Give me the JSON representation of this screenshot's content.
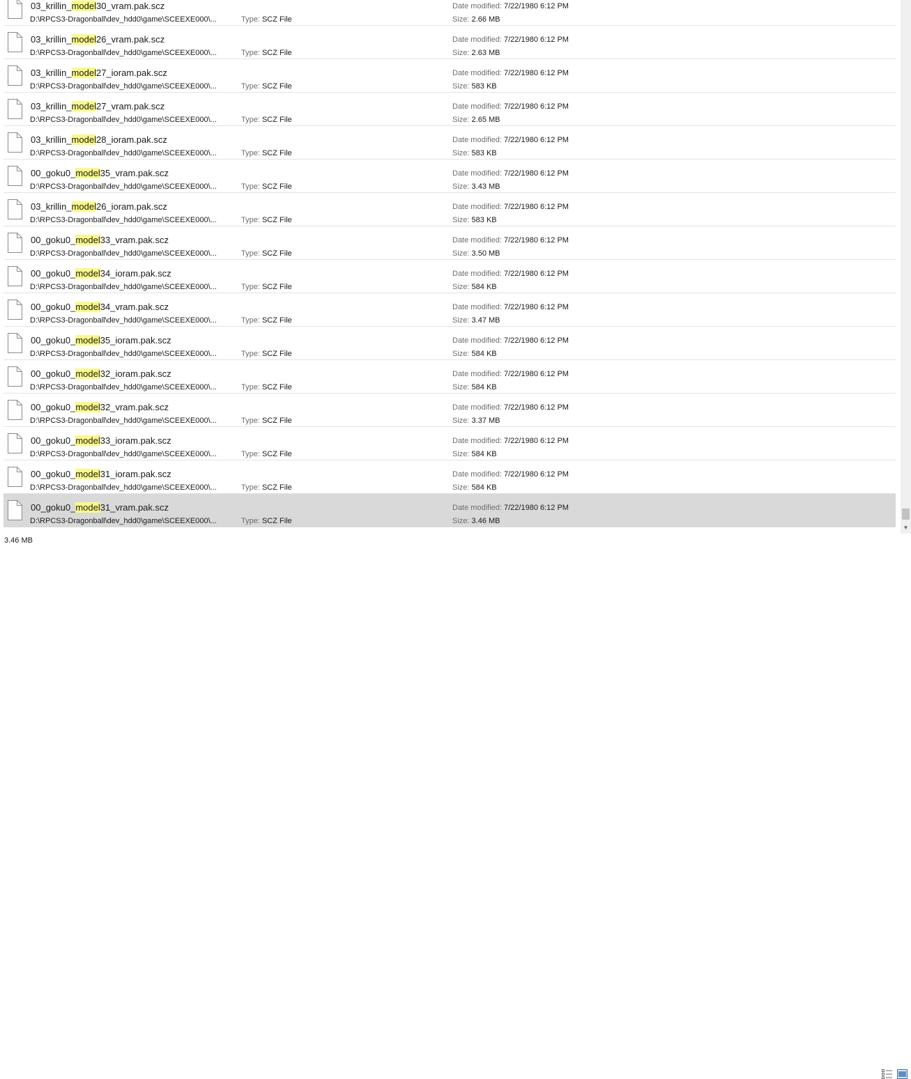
{
  "rows": [
    {
      "name_pre": "03_krillin_",
      "name_hl": "model",
      "name_post": "30_vram.pak.scz",
      "path": "D:\\RPCS3-Dragonball\\dev_hdd0\\game\\SCEEXE000\\...",
      "type_label": "Type:",
      "type": "SCZ File",
      "date_label": "Date modified:",
      "date": "7/22/1980 6:12 PM",
      "size_label": "Size:",
      "size": "2.66 MB"
    },
    {
      "name_pre": "03_krillin_",
      "name_hl": "model",
      "name_post": "26_vram.pak.scz",
      "path": "D:\\RPCS3-Dragonball\\dev_hdd0\\game\\SCEEXE000\\...",
      "type_label": "Type:",
      "type": "SCZ File",
      "date_label": "Date modified:",
      "date": "7/22/1980 6:12 PM",
      "size_label": "Size:",
      "size": "2.63 MB"
    },
    {
      "name_pre": "03_krillin_",
      "name_hl": "model",
      "name_post": "27_ioram.pak.scz",
      "path": "D:\\RPCS3-Dragonball\\dev_hdd0\\game\\SCEEXE000\\...",
      "type_label": "Type:",
      "type": "SCZ File",
      "date_label": "Date modified:",
      "date": "7/22/1980 6:12 PM",
      "size_label": "Size:",
      "size": "583 KB"
    },
    {
      "name_pre": "03_krillin_",
      "name_hl": "model",
      "name_post": "27_vram.pak.scz",
      "path": "D:\\RPCS3-Dragonball\\dev_hdd0\\game\\SCEEXE000\\...",
      "type_label": "Type:",
      "type": "SCZ File",
      "date_label": "Date modified:",
      "date": "7/22/1980 6:12 PM",
      "size_label": "Size:",
      "size": "2.65 MB"
    },
    {
      "name_pre": "03_krillin_",
      "name_hl": "model",
      "name_post": "28_ioram.pak.scz",
      "path": "D:\\RPCS3-Dragonball\\dev_hdd0\\game\\SCEEXE000\\...",
      "type_label": "Type:",
      "type": "SCZ File",
      "date_label": "Date modified:",
      "date": "7/22/1980 6:12 PM",
      "size_label": "Size:",
      "size": "583 KB"
    },
    {
      "name_pre": "00_goku0_",
      "name_hl": "model",
      "name_post": "35_vram.pak.scz",
      "path": "D:\\RPCS3-Dragonball\\dev_hdd0\\game\\SCEEXE000\\...",
      "type_label": "Type:",
      "type": "SCZ File",
      "date_label": "Date modified:",
      "date": "7/22/1980 6:12 PM",
      "size_label": "Size:",
      "size": "3.43 MB"
    },
    {
      "name_pre": "03_krillin_",
      "name_hl": "model",
      "name_post": "26_ioram.pak.scz",
      "path": "D:\\RPCS3-Dragonball\\dev_hdd0\\game\\SCEEXE000\\...",
      "type_label": "Type:",
      "type": "SCZ File",
      "date_label": "Date modified:",
      "date": "7/22/1980 6:12 PM",
      "size_label": "Size:",
      "size": "583 KB"
    },
    {
      "name_pre": "00_goku0_",
      "name_hl": "model",
      "name_post": "33_vram.pak.scz",
      "path": "D:\\RPCS3-Dragonball\\dev_hdd0\\game\\SCEEXE000\\...",
      "type_label": "Type:",
      "type": "SCZ File",
      "date_label": "Date modified:",
      "date": "7/22/1980 6:12 PM",
      "size_label": "Size:",
      "size": "3.50 MB"
    },
    {
      "name_pre": "00_goku0_",
      "name_hl": "model",
      "name_post": "34_ioram.pak.scz",
      "path": "D:\\RPCS3-Dragonball\\dev_hdd0\\game\\SCEEXE000\\...",
      "type_label": "Type:",
      "type": "SCZ File",
      "date_label": "Date modified:",
      "date": "7/22/1980 6:12 PM",
      "size_label": "Size:",
      "size": "584 KB"
    },
    {
      "name_pre": "00_goku0_",
      "name_hl": "model",
      "name_post": "34_vram.pak.scz",
      "path": "D:\\RPCS3-Dragonball\\dev_hdd0\\game\\SCEEXE000\\...",
      "type_label": "Type:",
      "type": "SCZ File",
      "date_label": "Date modified:",
      "date": "7/22/1980 6:12 PM",
      "size_label": "Size:",
      "size": "3.47 MB"
    },
    {
      "name_pre": "00_goku0_",
      "name_hl": "model",
      "name_post": "35_ioram.pak.scz",
      "path": "D:\\RPCS3-Dragonball\\dev_hdd0\\game\\SCEEXE000\\...",
      "type_label": "Type:",
      "type": "SCZ File",
      "date_label": "Date modified:",
      "date": "7/22/1980 6:12 PM",
      "size_label": "Size:",
      "size": "584 KB"
    },
    {
      "name_pre": "00_goku0_",
      "name_hl": "model",
      "name_post": "32_ioram.pak.scz",
      "path": "D:\\RPCS3-Dragonball\\dev_hdd0\\game\\SCEEXE000\\...",
      "type_label": "Type:",
      "type": "SCZ File",
      "date_label": "Date modified:",
      "date": "7/22/1980 6:12 PM",
      "size_label": "Size:",
      "size": "584 KB"
    },
    {
      "name_pre": "00_goku0_",
      "name_hl": "model",
      "name_post": "32_vram.pak.scz",
      "path": "D:\\RPCS3-Dragonball\\dev_hdd0\\game\\SCEEXE000\\...",
      "type_label": "Type:",
      "type": "SCZ File",
      "date_label": "Date modified:",
      "date": "7/22/1980 6:12 PM",
      "size_label": "Size:",
      "size": "3.37 MB"
    },
    {
      "name_pre": "00_goku0_",
      "name_hl": "model",
      "name_post": "33_ioram.pak.scz",
      "path": "D:\\RPCS3-Dragonball\\dev_hdd0\\game\\SCEEXE000\\...",
      "type_label": "Type:",
      "type": "SCZ File",
      "date_label": "Date modified:",
      "date": "7/22/1980 6:12 PM",
      "size_label": "Size:",
      "size": "584 KB"
    },
    {
      "name_pre": "00_goku0_",
      "name_hl": "model",
      "name_post": "31_ioram.pak.scz",
      "path": "D:\\RPCS3-Dragonball\\dev_hdd0\\game\\SCEEXE000\\...",
      "type_label": "Type:",
      "type": "SCZ File",
      "date_label": "Date modified:",
      "date": "7/22/1980 6:12 PM",
      "size_label": "Size:",
      "size": "584 KB"
    },
    {
      "name_pre": "00_goku0_",
      "name_hl": "model",
      "name_post": "31_vram.pak.scz",
      "path": "D:\\RPCS3-Dragonball\\dev_hdd0\\game\\SCEEXE000\\...",
      "type_label": "Type:",
      "type": "SCZ File",
      "date_label": "Date modified:",
      "date": "7/22/1980 6:12 PM",
      "size_label": "Size:",
      "size": "3.46 MB",
      "selected": true
    }
  ],
  "status": {
    "selection_size": "3.46 MB"
  },
  "icons": {
    "file": "file-icon",
    "details_view": "details-view-icon",
    "tiles_view": "tiles-view-icon",
    "scroll_down": "chevron-down-icon"
  },
  "colors": {
    "highlight": "#fafa86",
    "selected_row": "#d9d9d9",
    "label_gray": "#6d6d6d"
  }
}
